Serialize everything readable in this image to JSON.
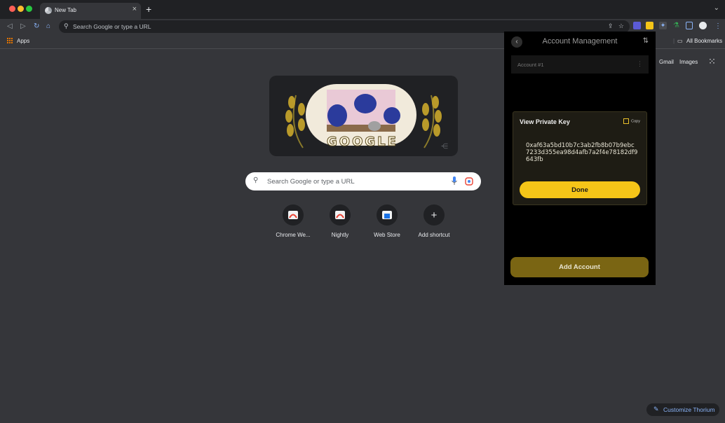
{
  "window": {
    "traffic_lights": {
      "close": "#ff5f57",
      "minimize": "#febc2e",
      "zoom": "#28c840"
    }
  },
  "tabs": [
    {
      "title": "New Tab",
      "icon": "chromium-icon",
      "active": true
    }
  ],
  "tabbar": {
    "new_tab_icon": "+",
    "search_tabs_icon": "chevron-down-icon"
  },
  "toolbar": {
    "omnibox_placeholder": "Search Google or type a URL",
    "extensions": [
      {
        "name": "extension-icon",
        "color": "#5b5bd6"
      },
      {
        "name": "extension-icon",
        "color": "#f5c518"
      },
      {
        "name": "puzzle-icon",
        "color": "#8ab4f8"
      },
      {
        "name": "extension-icon",
        "color": "#34a853"
      },
      {
        "name": "sidepanel-icon",
        "color": "#8ab4f8"
      },
      {
        "name": "profile-icon",
        "color": "#e8eaed"
      }
    ]
  },
  "bookmarks_bar": {
    "apps_label": "Apps",
    "all_bookmarks_label": "All Bookmarks"
  },
  "ntp": {
    "doodle_text": "GOOGLE",
    "search_placeholder": "Search Google or type a URL",
    "shortcuts": [
      {
        "label": "Chrome We..."
      },
      {
        "label": "Nightly"
      },
      {
        "label": "Web Store"
      },
      {
        "label": "Add shortcut"
      }
    ],
    "links": {
      "gmail": "Gmail",
      "images": "Images"
    },
    "customize_label": "Customize Thorium"
  },
  "wallet_panel": {
    "title": "Account Management",
    "account_name": "Account #1",
    "private_key_card": {
      "heading": "View Private Key",
      "copy_label": "Copy",
      "key": "0xaf63a5bd10b7c3ab2fb8b07b9ebc7233d355ea98d4afb7a2f4e78182df9643fb",
      "done_label": "Done"
    },
    "add_account_label": "Add Account",
    "accent_color": "#f5c518"
  }
}
